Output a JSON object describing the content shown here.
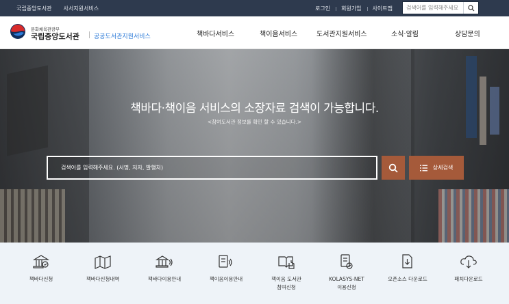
{
  "topbar": {
    "left_links": [
      "국립중앙도서관",
      "사서지원서비스"
    ],
    "right_links": [
      "로그인",
      "회원가입",
      "사이트맵"
    ],
    "search_placeholder": "검색어를 입력해주세요"
  },
  "header": {
    "ministry": "문화체육관광부",
    "library": "국립중앙도서관",
    "service": "공공도서관지원서비스",
    "nav": [
      "책바다서비스",
      "책이음서비스",
      "도서관지원서비스",
      "소식·알림",
      "상담문의"
    ]
  },
  "hero": {
    "title": "책바다·책이음 서비스의 소장자료 검색이 가능합니다.",
    "subtitle": "<참여도서관 정보를 확인 할 수 있습니다.>",
    "search_placeholder": "검색어를 입력해주세요. (서명, 저자, 발행처)",
    "advanced_label": "상세검색"
  },
  "quick_menu": [
    {
      "label": "책바다신청",
      "icon": "library-building-icon"
    },
    {
      "label": "책바다신청내역",
      "icon": "book-map-icon"
    },
    {
      "label": "책바다이용안내",
      "icon": "library-speaker-icon"
    },
    {
      "label": "책이음이용안내",
      "icon": "card-speaker-icon"
    },
    {
      "label": "책이음 도서관\n참여신청",
      "icon": "book-hand-icon"
    },
    {
      "label": "KOLASYS-NET\n이용신청",
      "icon": "document-check-icon"
    },
    {
      "label": "오픈소스 다운로드",
      "icon": "file-download-icon"
    },
    {
      "label": "패치다운로드",
      "icon": "cloud-download-icon"
    }
  ],
  "colors": {
    "topbar": "#2e3a4e",
    "accent_blue": "#2d7bd8",
    "search_button": "#a55a3a",
    "quick_bg": "#eef3f8"
  }
}
